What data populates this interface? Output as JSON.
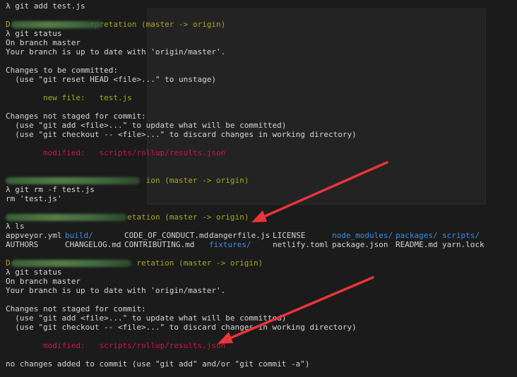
{
  "lines": [
    {
      "text": "λ git add test.js",
      "style": "default"
    },
    {
      "text": "D                 rpretation (master -> origin)",
      "style": "olive"
    },
    {
      "text": "λ git status",
      "style": "default"
    },
    {
      "text": "On branch master",
      "style": "default"
    },
    {
      "text": "Your branch is up to date with 'origin/master'.",
      "style": "default"
    },
    {
      "text": "Changes to be committed:",
      "style": "default"
    },
    {
      "text": "  (use \"git reset HEAD <file>...\" to unstage)",
      "style": "default"
    },
    {
      "text": "        new file:   test.js",
      "style": "olive"
    },
    {
      "text": "Changes not staged for commit:",
      "style": "default"
    },
    {
      "text": "  (use \"git add <file>...\" to update what will be committed)",
      "style": "default"
    },
    {
      "text": "  (use \"git checkout -- <file>...\" to discard changes in working directory)",
      "style": "default"
    },
    {
      "text": "        modified:   scripts/rollup/results.json",
      "style": "red"
    },
    {
      "text": "                              ion (master -> origin)",
      "style": "olive"
    },
    {
      "text": "λ git rm -f test.js",
      "style": "default"
    },
    {
      "text": "rm 'test.js'",
      "style": "default"
    },
    {
      "text": "                          etation (master -> origin)",
      "style": "olive"
    },
    {
      "text": "λ ls",
      "style": "default"
    },
    {
      "text": "D                           retation (master -> origin)",
      "style": "olive"
    },
    {
      "text": "λ git status",
      "style": "default"
    },
    {
      "text": "On branch master",
      "style": "default"
    },
    {
      "text": "Your branch is up to date with 'origin/master'.",
      "style": "default"
    },
    {
      "text": "Changes not staged for commit:",
      "style": "default"
    },
    {
      "text": "  (use \"git add <file>...\" to update what will be committed)",
      "style": "default"
    },
    {
      "text": "  (use \"git checkout -- <file>...\" to discard changes in working directory)",
      "style": "default"
    },
    {
      "text": "        modified:   scripts/rollup/results.json",
      "style": "red"
    },
    {
      "text": "no changes added to commit (use \"git add\" and/or \"git commit -a\")",
      "style": "default"
    }
  ],
  "ls_row1": [
    {
      "text": "appveyor.yml",
      "style": "default"
    },
    {
      "text": "build/",
      "style": "blue"
    },
    {
      "text": "CODE_OF_CONDUCT.md",
      "style": "default"
    },
    {
      "text": "dangerfile.js",
      "style": "default"
    },
    {
      "text": "LICENSE",
      "style": "default"
    },
    {
      "text": "node_modules/",
      "style": "blue"
    },
    {
      "text": "packages/",
      "style": "blue"
    },
    {
      "text": "scripts/",
      "style": "blue"
    }
  ],
  "ls_row2": [
    {
      "text": "AUTHORS",
      "style": "default"
    },
    {
      "text": "CHANGELOG.md",
      "style": "default"
    },
    {
      "text": "CONTRIBUTING.md",
      "style": "default"
    },
    {
      "text": "fixtures/",
      "style": "blue"
    },
    {
      "text": "netlify.toml",
      "style": "default"
    },
    {
      "text": "package.json",
      "style": "default"
    },
    {
      "text": "README.md",
      "style": "default"
    },
    {
      "text": "yarn.lock",
      "style": "default"
    }
  ],
  "colors": {
    "background": "#1b1b1b",
    "text": "#d6d6d6",
    "olive": "#a4a820",
    "red": "#d0134a",
    "blue": "#3b8eea",
    "arrow": "#e8353a"
  }
}
